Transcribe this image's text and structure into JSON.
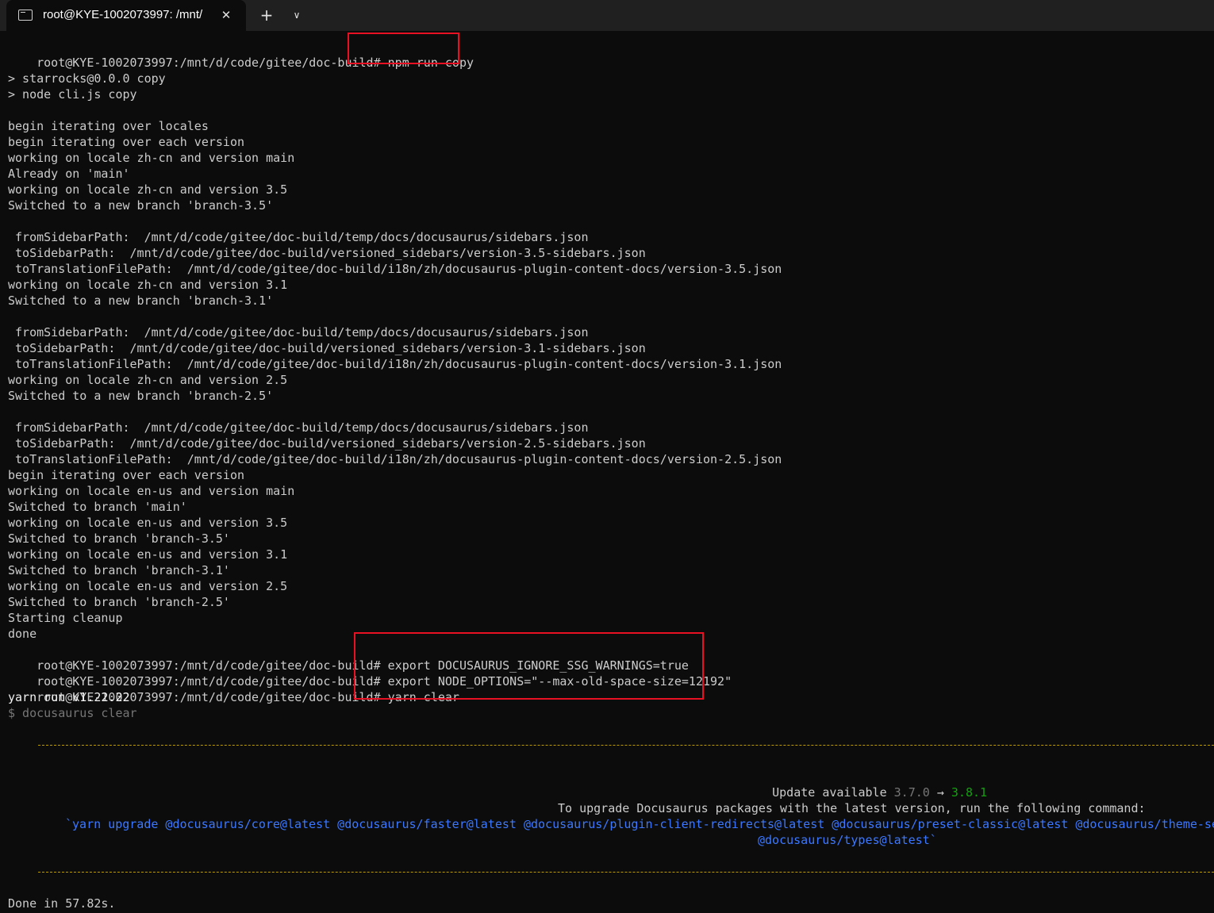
{
  "tab": {
    "title": "root@KYE-1002073997: /mnt/",
    "close_icon": "close-icon",
    "new_tab_icon": "plus-icon",
    "dropdown_icon": "chevron-down-icon"
  },
  "terminal": {
    "prompt": "root@KYE-1002073997:/mnt/d/code/gitee/doc-build#",
    "cmd_copy": " npm run copy",
    "output_lines": [
      "> starrocks@0.0.0 copy",
      "> node cli.js copy",
      "",
      "begin iterating over locales",
      "begin iterating over each version",
      "working on locale zh-cn and version main",
      "Already on 'main'",
      "working on locale zh-cn and version 3.5",
      "Switched to a new branch 'branch-3.5'",
      "",
      " fromSidebarPath:  /mnt/d/code/gitee/doc-build/temp/docs/docusaurus/sidebars.json",
      " toSidebarPath:  /mnt/d/code/gitee/doc-build/versioned_sidebars/version-3.5-sidebars.json",
      " toTranslationFilePath:  /mnt/d/code/gitee/doc-build/i18n/zh/docusaurus-plugin-content-docs/version-3.5.json",
      "working on locale zh-cn and version 3.1",
      "Switched to a new branch 'branch-3.1'",
      "",
      " fromSidebarPath:  /mnt/d/code/gitee/doc-build/temp/docs/docusaurus/sidebars.json",
      " toSidebarPath:  /mnt/d/code/gitee/doc-build/versioned_sidebars/version-3.1-sidebars.json",
      " toTranslationFilePath:  /mnt/d/code/gitee/doc-build/i18n/zh/docusaurus-plugin-content-docs/version-3.1.json",
      "working on locale zh-cn and version 2.5",
      "Switched to a new branch 'branch-2.5'",
      "",
      " fromSidebarPath:  /mnt/d/code/gitee/doc-build/temp/docs/docusaurus/sidebars.json",
      " toSidebarPath:  /mnt/d/code/gitee/doc-build/versioned_sidebars/version-2.5-sidebars.json",
      " toTranslationFilePath:  /mnt/d/code/gitee/doc-build/i18n/zh/docusaurus-plugin-content-docs/version-2.5.json",
      "begin iterating over each version",
      "working on locale en-us and version main",
      "Switched to branch 'main'",
      "working on locale en-us and version 3.5",
      "Switched to branch 'branch-3.5'",
      "working on locale en-us and version 3.1",
      "Switched to branch 'branch-3.1'",
      "working on locale en-us and version 2.5",
      "Switched to branch 'branch-2.5'",
      "Starting cleanup",
      "done"
    ],
    "cmd_export1": " export DOCUSAURUS_IGNORE_SSG_WARNINGS=true",
    "cmd_export2": " export NODE_OPTIONS=\"--max-old-space-size=12192\"",
    "cmd_yarn": " yarn clear",
    "yarn_version": "yarn run v1.22.22",
    "yarn_cmd": "$ docusaurus clear",
    "update_label": "Update available ",
    "update_from": "3.7.0",
    "update_arrow": " → ",
    "update_to": "3.8.1",
    "upgrade_msg": "To upgrade Docusaurus packages with the latest version, run the following command:",
    "upgrade_cmd_1": "`yarn upgrade @docusaurus/core@latest @docusaurus/faster@latest @docusaurus/plugin-client-redirects@latest @docusaurus/preset-classic@latest @docusaurus/theme-search-algolia@latest",
    "upgrade_cmd_2": "@docusaurus/types@latest`",
    "done_msg": "Done in 57.82s."
  },
  "colors": {
    "background": "#0c0c0c",
    "foreground": "#cccccc",
    "highlight_box": "#e81123",
    "dashed_rule": "#c19c00",
    "version_new": "#13a10e",
    "upgrade_cmd": "#3b78ff"
  }
}
